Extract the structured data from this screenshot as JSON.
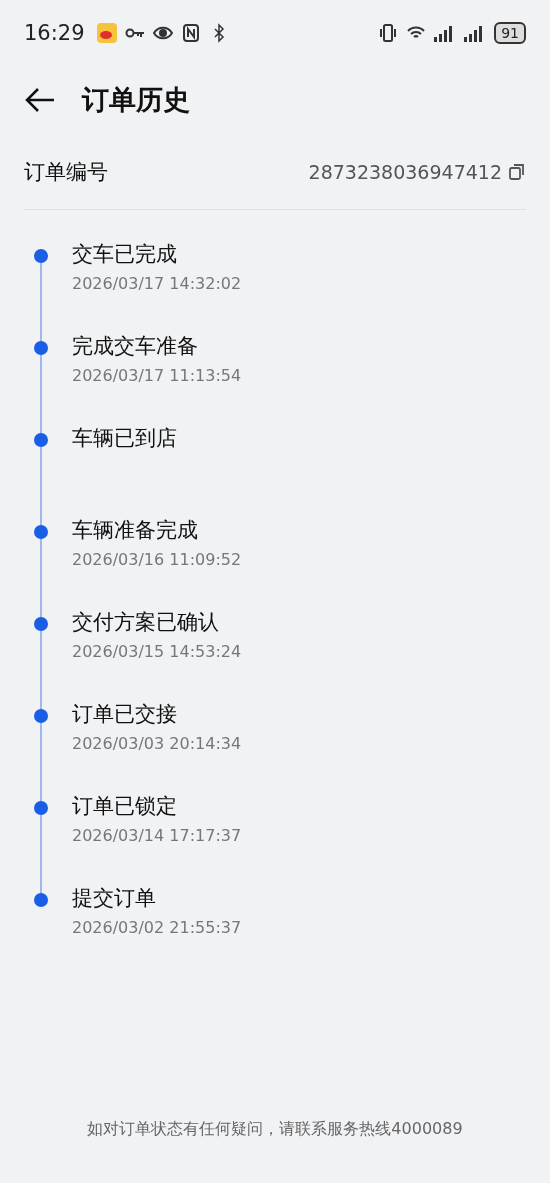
{
  "status_bar": {
    "time": "16:29",
    "battery": "91"
  },
  "header": {
    "title": "订单历史"
  },
  "order": {
    "label": "订单编号",
    "number": "2873238036947412"
  },
  "timeline": [
    {
      "title": "交车已完成",
      "time": "2026/03/17 14:32:02"
    },
    {
      "title": "完成交车准备",
      "time": "2026/03/17 11:13:54"
    },
    {
      "title": "车辆已到店"
    },
    {
      "title": "车辆准备完成",
      "time": "2026/03/16 11:09:52"
    },
    {
      "title": "交付方案已确认",
      "time": "2026/03/15 14:53:24"
    },
    {
      "title": "订单已交接",
      "time": "2026/03/03 20:14:34"
    },
    {
      "title": "订单已锁定",
      "time": "2026/03/14 17:17:37"
    },
    {
      "title": "提交订单",
      "time": "2026/03/02 21:55:37"
    }
  ],
  "footer": {
    "note": "如对订单状态有任何疑问，请联系服务热线4000089"
  }
}
